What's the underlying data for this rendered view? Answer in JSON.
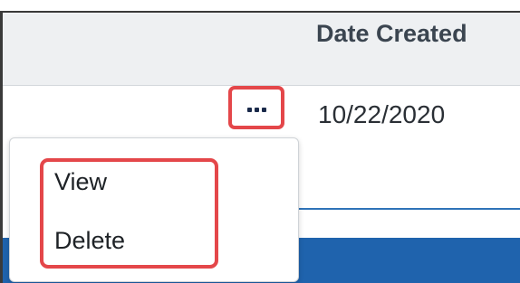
{
  "table": {
    "header": {
      "date_created_label": "Date Created"
    },
    "row": {
      "date_created": "10/22/2020",
      "more_button_label": "..."
    }
  },
  "row_menu": {
    "items": [
      {
        "label": "View"
      },
      {
        "label": "Delete"
      }
    ]
  },
  "colors": {
    "highlight": "#e4474a",
    "header_bg": "#eef0f2",
    "accent_blue": "#1f63ad"
  },
  "icons": {
    "more": "ellipsis-icon"
  }
}
